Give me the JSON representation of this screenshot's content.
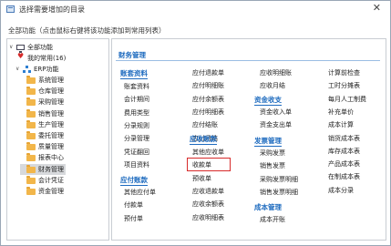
{
  "window": {
    "title": "选择需要增加的目录",
    "close_glyph": "✕",
    "hint": "全部功能（点击鼠标右键将该功能添加到常用列表）"
  },
  "tree": {
    "root": "全部功能",
    "favorites": "我的常用(16)",
    "erp": "ERP功能",
    "items": [
      "系统管理",
      "仓库管理",
      "采购管理",
      "销售管理",
      "生产管理",
      "委托管理",
      "质量管理",
      "报表中心",
      "财务管理",
      "会计凭证",
      "资金管理"
    ],
    "selected": "财务管理"
  },
  "main": {
    "section_title": "财务管理",
    "col1": {
      "cat1": "账套资料",
      "cat1_items": [
        "账套资料",
        "会计期间",
        "费用类型",
        "分录规则",
        "分录管理",
        "凭证翻回",
        "项目资料"
      ],
      "cat2": "应付账款",
      "cat2_items": [
        "其他应付单",
        "付款单",
        "预付单"
      ]
    },
    "col2": {
      "items_top": [
        "应付退款单",
        "应付明细账",
        "应付余额表",
        "应付明细表",
        "应付结账",
        "应付月结"
      ],
      "cat": "应收账款",
      "cat_items": [
        "其他应收单",
        "收款单",
        "预收单",
        "应收退款单",
        "应收余额表",
        "应收明细表"
      ]
    },
    "col3": {
      "items_top": [
        "应收明细账",
        "应收月结"
      ],
      "cat1": "资金收支",
      "cat1_items": [
        "资金收入单",
        "资金支出单"
      ],
      "cat2": "发票管理",
      "cat2_items": [
        "采购发票",
        "销售发票",
        "采购发票明细",
        "销售发票明细"
      ],
      "cat3": "成本管理",
      "cat3_items": [
        "成本开账"
      ]
    },
    "col4": {
      "items": [
        "计算前检查",
        "工时分摊表",
        "每月人工制费",
        "补充单价",
        "成本计算",
        "销货成本表",
        "库存成本表",
        "产品成本表",
        "在制成本表",
        "成本分录"
      ]
    },
    "highlighted": "收款单"
  }
}
